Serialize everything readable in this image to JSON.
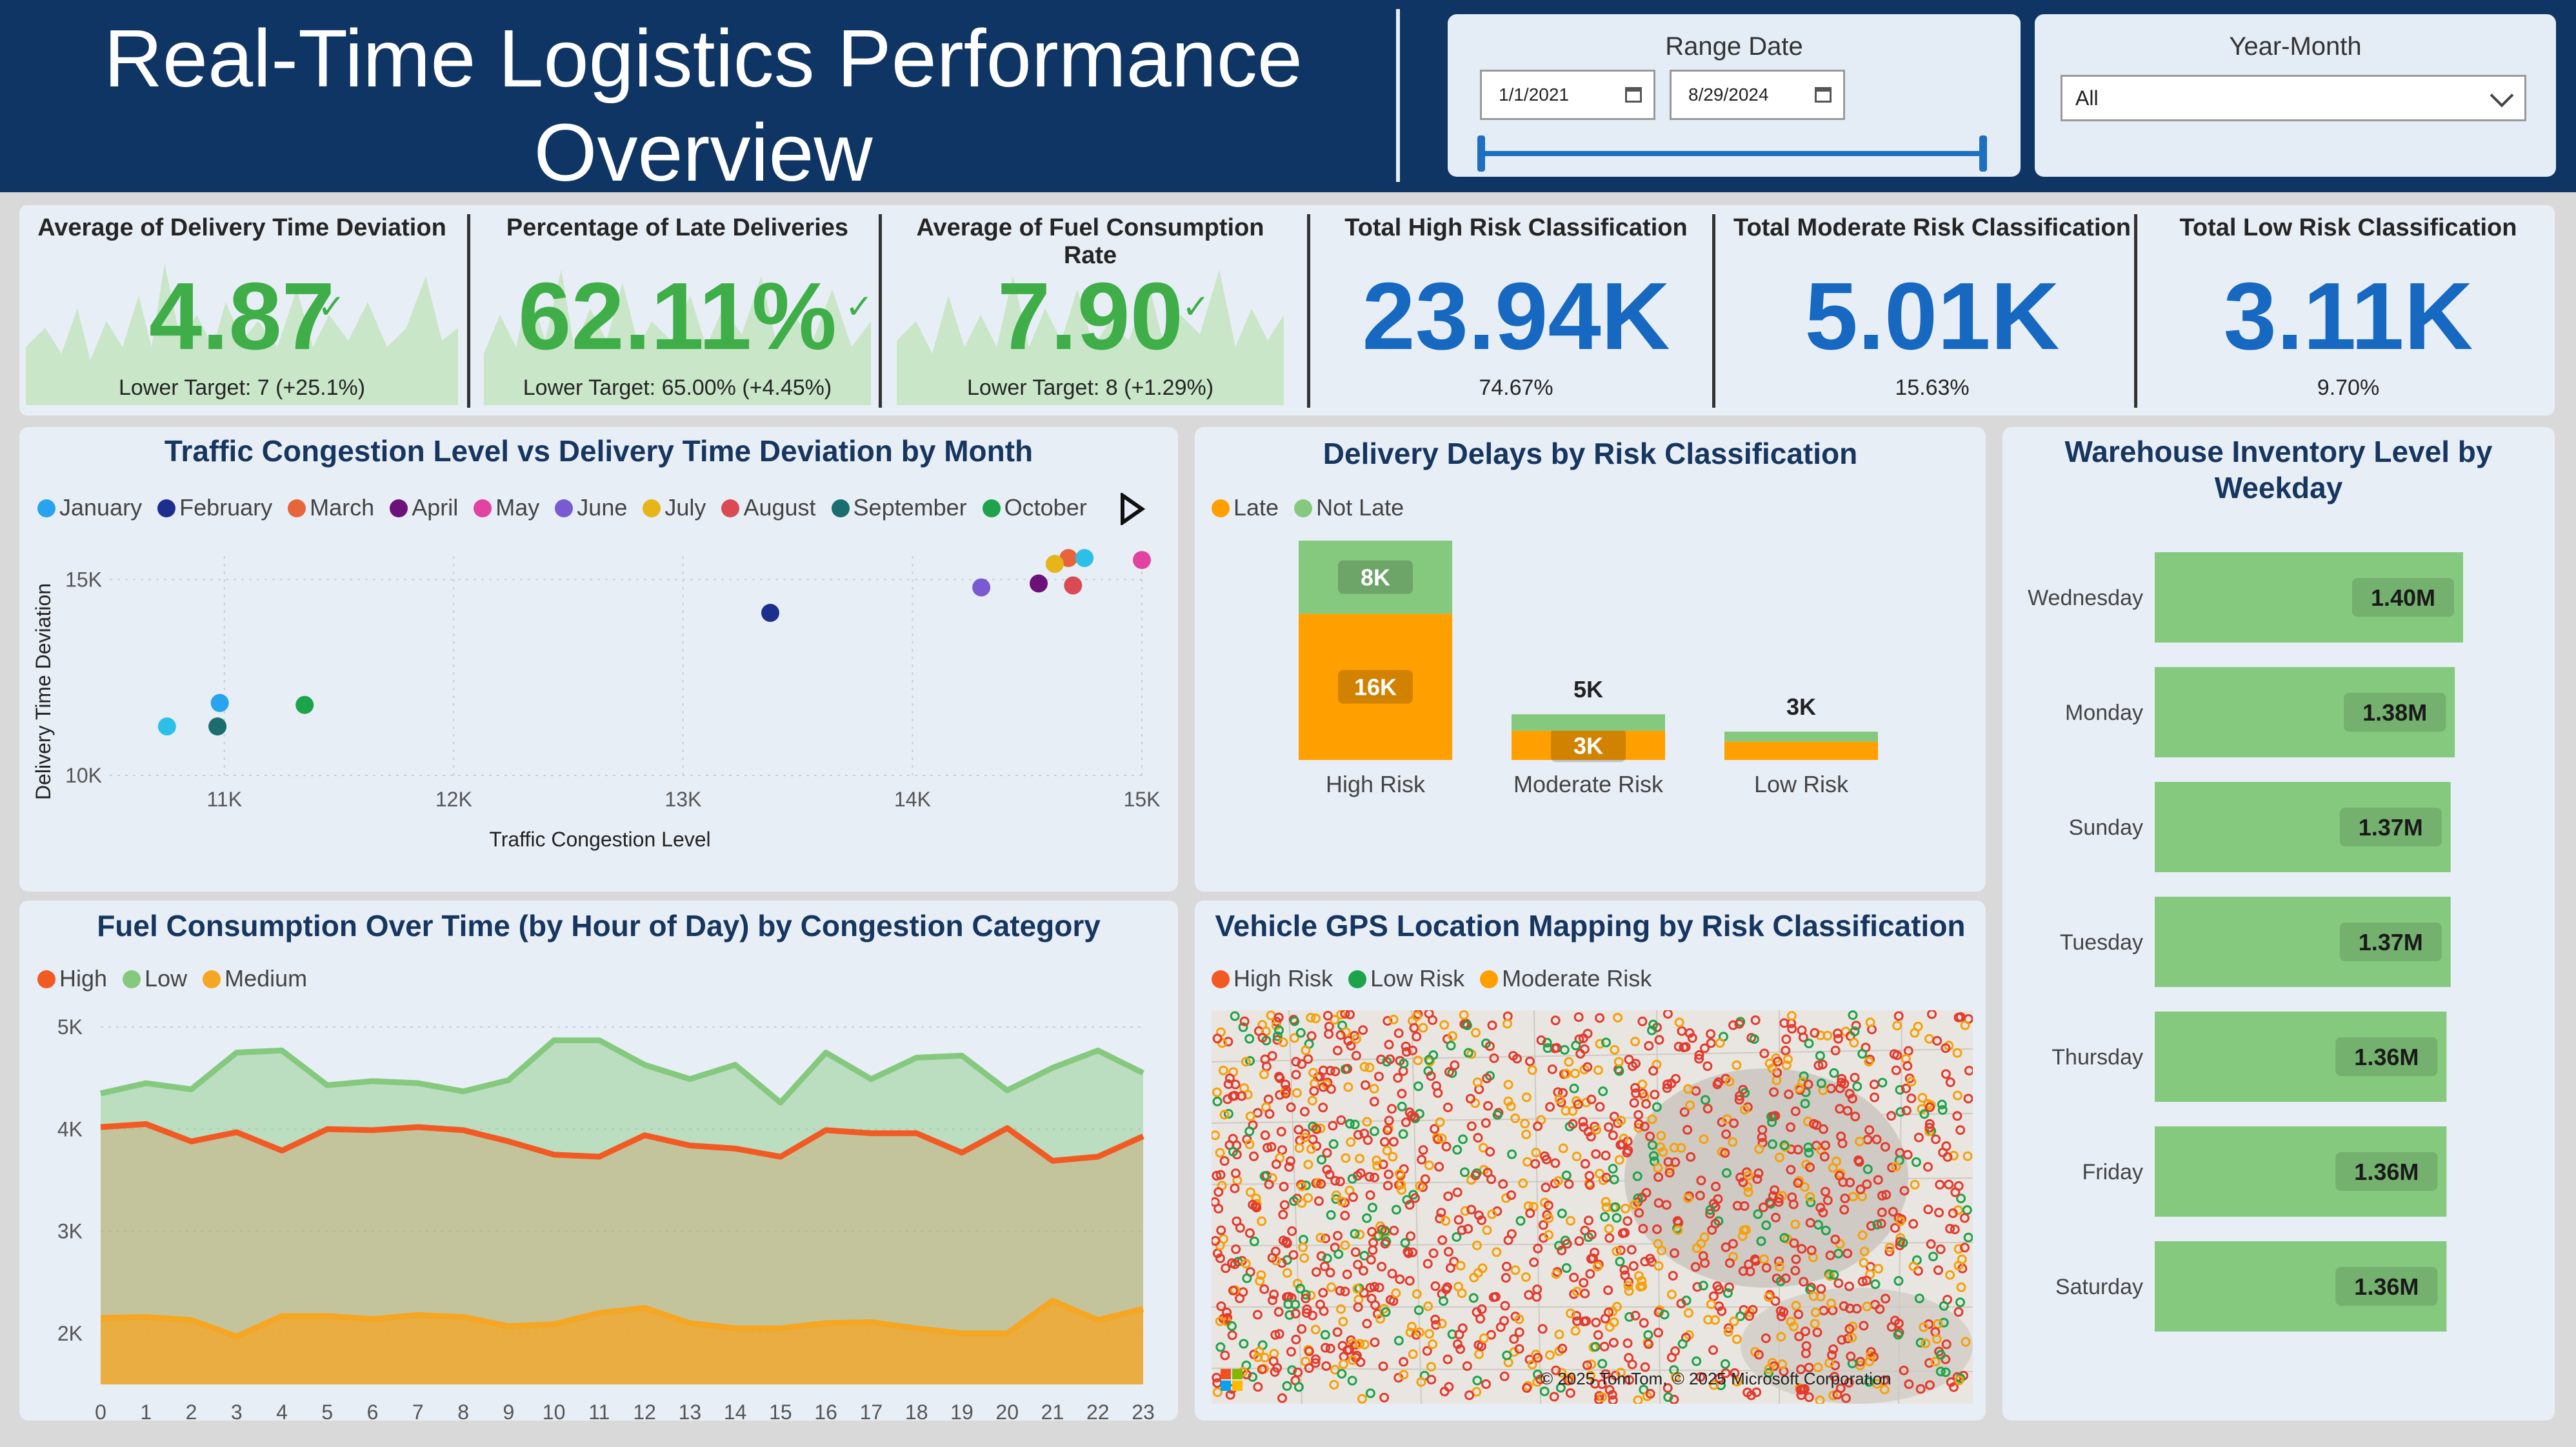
{
  "header": {
    "title_line1": "Real-Time Logistics Performance",
    "title_line2": "Overview"
  },
  "slicers": {
    "range_date": {
      "title": "Range Date",
      "start": "1/1/2021",
      "end": "8/29/2024"
    },
    "year_month": {
      "title": "Year-Month",
      "selected": "All"
    }
  },
  "kpis": [
    {
      "title": "Average of Delivery Time Deviation",
      "value": "4.87",
      "sub": "Lower Target: 7 (+25.1%)",
      "style": "green"
    },
    {
      "title": "Percentage of Late Deliveries",
      "value": "62.11%",
      "sub": "Lower Target: 65.00% (+4.45%)",
      "style": "green"
    },
    {
      "title": "Average of Fuel Consumption Rate",
      "value": "7.90",
      "sub": "Lower Target: 8 (+1.29%)",
      "style": "green"
    },
    {
      "title": "Total High Risk Classification",
      "value": "23.94K",
      "sub": "74.67%",
      "style": "blue"
    },
    {
      "title": "Total Moderate Risk Classification",
      "value": "5.01K",
      "sub": "15.63%",
      "style": "blue"
    },
    {
      "title": "Total Low Risk Classification",
      "value": "3.11K",
      "sub": "9.70%",
      "style": "blue"
    }
  ],
  "colors": {
    "header_bg": "#0e3564",
    "kpi_green": "#3fae49",
    "kpi_blue": "#1668c0",
    "late": "#ff9f00",
    "not_late": "#85c97e",
    "high": "#f25a24",
    "low": "#85c97e",
    "medium": "#f5a623",
    "moderate_risk": "#ff9f00",
    "warehouse_bar": "#85c97e"
  },
  "chart_data": [
    {
      "type": "scatter",
      "title": "Traffic Congestion Level vs Delivery Time Deviation by Month",
      "xlabel": "Traffic Congestion Level",
      "ylabel": "Delivery Time Deviation",
      "xlim": [
        10500,
        15000
      ],
      "ylim": [
        10000,
        15600
      ],
      "x_ticks": [
        "11K",
        "12K",
        "13K",
        "14K",
        "15K"
      ],
      "y_ticks": [
        "10K",
        "15K"
      ],
      "legend_has_more": true,
      "series": [
        {
          "name": "January",
          "color": "#27a3f0",
          "points": [
            [
              10980,
              11850
            ]
          ]
        },
        {
          "name": "February",
          "color": "#1c2f8f",
          "points": [
            [
              13380,
              14150
            ]
          ]
        },
        {
          "name": "March",
          "color": "#e8643a",
          "points": [
            [
              14680,
              15550
            ]
          ]
        },
        {
          "name": "April",
          "color": "#6b1179",
          "points": [
            [
              14550,
              14900
            ]
          ]
        },
        {
          "name": "May",
          "color": "#e043a0",
          "points": [
            [
              15000,
              15500
            ]
          ]
        },
        {
          "name": "June",
          "color": "#7a5ad0",
          "points": [
            [
              14300,
              14800
            ]
          ]
        },
        {
          "name": "July",
          "color": "#e6b51a",
          "points": [
            [
              14620,
              15400
            ]
          ]
        },
        {
          "name": "August",
          "color": "#d94a55",
          "points": [
            [
              14700,
              14850
            ]
          ]
        },
        {
          "name": "September",
          "color": "#1b6d6f",
          "points": [
            [
              10970,
              11250
            ]
          ]
        },
        {
          "name": "October",
          "color": "#1da34a",
          "points": [
            [
              11350,
              11800
            ]
          ]
        },
        {
          "name": "",
          "color": "#2cc0e8",
          "points": [
            [
              10750,
              11250
            ],
            [
              14750,
              15550
            ]
          ]
        }
      ]
    },
    {
      "type": "bar",
      "title": "Delivery Delays by Risk Classification",
      "categories": [
        "High Risk",
        "Moderate Risk",
        "Low Risk"
      ],
      "totals": [
        "24K",
        "5K",
        "3K"
      ],
      "series": [
        {
          "name": "Late",
          "values": [
            16000,
            3200,
            2000
          ],
          "labels": [
            "16K",
            "3K",
            ""
          ]
        },
        {
          "name": "Not Late",
          "values": [
            8000,
            1800,
            1100
          ],
          "labels": [
            "8K",
            "",
            ""
          ]
        }
      ],
      "ymax": 24000
    },
    {
      "type": "bar",
      "title": "Warehouse Inventory Level by Weekday",
      "orientation": "horizontal",
      "categories": [
        "Wednesday",
        "Monday",
        "Sunday",
        "Tuesday",
        "Thursday",
        "Friday",
        "Saturday"
      ],
      "values": [
        1.4,
        1.38,
        1.37,
        1.37,
        1.36,
        1.36,
        1.36
      ],
      "labels": [
        "1.40M",
        "1.38M",
        "1.37M",
        "1.37M",
        "1.36M",
        "1.36M",
        "1.36M"
      ]
    },
    {
      "type": "area",
      "title": "Fuel Consumption Over Time (by Hour of Day) by Congestion Category",
      "x": [
        0,
        1,
        2,
        3,
        4,
        5,
        6,
        7,
        8,
        9,
        10,
        11,
        12,
        13,
        14,
        15,
        16,
        17,
        18,
        19,
        20,
        21,
        22,
        23
      ],
      "ylim": [
        1500,
        5000
      ],
      "y_ticks": [
        "2K",
        "3K",
        "4K",
        "5K"
      ],
      "series": [
        {
          "name": "High",
          "values": [
            4020,
            4050,
            3880,
            3970,
            3790,
            4000,
            3990,
            4020,
            3990,
            3880,
            3750,
            3730,
            3940,
            3840,
            3810,
            3730,
            3990,
            3960,
            3960,
            3770,
            4010,
            3690,
            3730,
            3930
          ]
        },
        {
          "name": "Low",
          "values": [
            4350,
            4450,
            4390,
            4750,
            4770,
            4430,
            4470,
            4450,
            4370,
            4480,
            4870,
            4870,
            4630,
            4490,
            4630,
            4260,
            4750,
            4490,
            4700,
            4720,
            4380,
            4600,
            4770,
            4550
          ]
        },
        {
          "name": "Medium",
          "values": [
            2150,
            2160,
            2130,
            1970,
            2170,
            2170,
            2140,
            2180,
            2160,
            2070,
            2090,
            2200,
            2250,
            2100,
            2050,
            2050,
            2100,
            2110,
            2050,
            2000,
            2000,
            2320,
            2130,
            2240
          ]
        }
      ]
    }
  ],
  "gps_map": {
    "title": "Vehicle GPS Location Mapping by Risk Classification",
    "legend": [
      "High Risk",
      "Low Risk",
      "Moderate Risk"
    ],
    "copyright": "© 2025 TomTom, © 2025 Microsoft Corporation"
  },
  "legends": {
    "scatter": [
      "January",
      "February",
      "March",
      "April",
      "May",
      "June",
      "July",
      "August",
      "September",
      "October"
    ],
    "delays": [
      "Late",
      "Not Late"
    ],
    "fuel": [
      "High",
      "Low",
      "Medium"
    ]
  }
}
